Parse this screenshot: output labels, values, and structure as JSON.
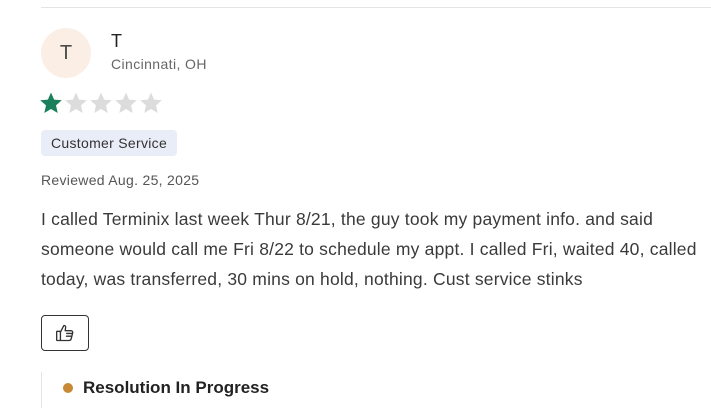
{
  "review": {
    "avatar_initial": "T",
    "reviewer_name": "T",
    "reviewer_location": "Cincinnati, OH",
    "rating": 1,
    "rating_max": 5,
    "category": "Customer Service",
    "date": "Reviewed Aug. 25, 2025",
    "text": "I called Terminix last week Thur 8/21, the guy took my payment info. and said someone would call me Fri 8/22 to schedule my appt. I called Fri, waited 40, called today, was transferred, 30 mins on hold, nothing. Cust service stinks",
    "helpful_icon": "thumbs-up-icon",
    "resolution_status": "Resolution In Progress"
  },
  "colors": {
    "star_filled": "#1a7f5a",
    "star_empty": "#dcdcdc",
    "status_dot": "#c98a35",
    "avatar_bg": "#fbeee4",
    "badge_bg": "#e9edf7"
  }
}
